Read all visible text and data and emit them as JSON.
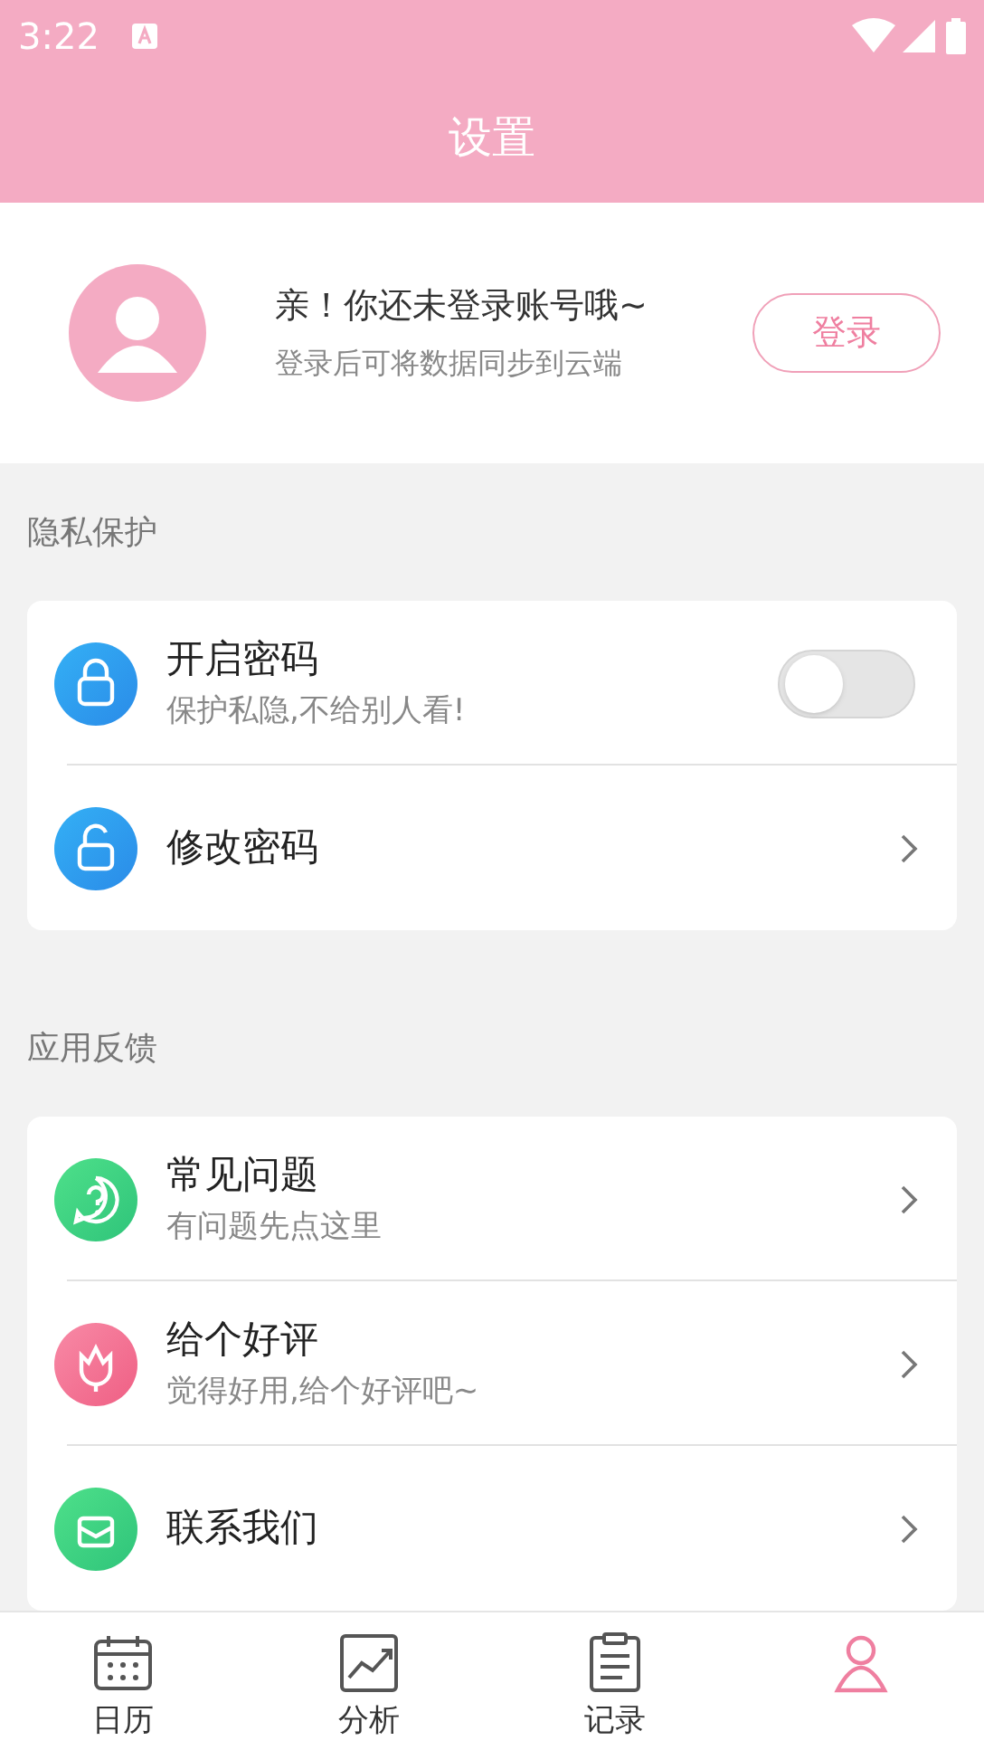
{
  "status_bar": {
    "time": "3:22"
  },
  "header": {
    "title": "设置"
  },
  "profile": {
    "greeting": "亲！你还未登录账号哦~",
    "hint": "登录后可将数据同步到云端",
    "login_button": "登录"
  },
  "sections": [
    {
      "title": "隐私保护",
      "items": [
        {
          "kind": "toggle",
          "title": "开启密码",
          "subtitle": "保护私隐,不给别人看!",
          "on": false
        },
        {
          "kind": "link",
          "title": "修改密码"
        }
      ]
    },
    {
      "title": "应用反馈",
      "items": [
        {
          "kind": "link",
          "title": "常见问题",
          "subtitle": "有问题先点这里"
        },
        {
          "kind": "link",
          "title": "给个好评",
          "subtitle": "觉得好用,给个好评吧~"
        },
        {
          "kind": "link",
          "title": "联系我们"
        }
      ]
    }
  ],
  "tabs": [
    {
      "label": "日历",
      "selected": false
    },
    {
      "label": "分析",
      "selected": false
    },
    {
      "label": "记录",
      "selected": false
    },
    {
      "selected": true
    }
  ]
}
